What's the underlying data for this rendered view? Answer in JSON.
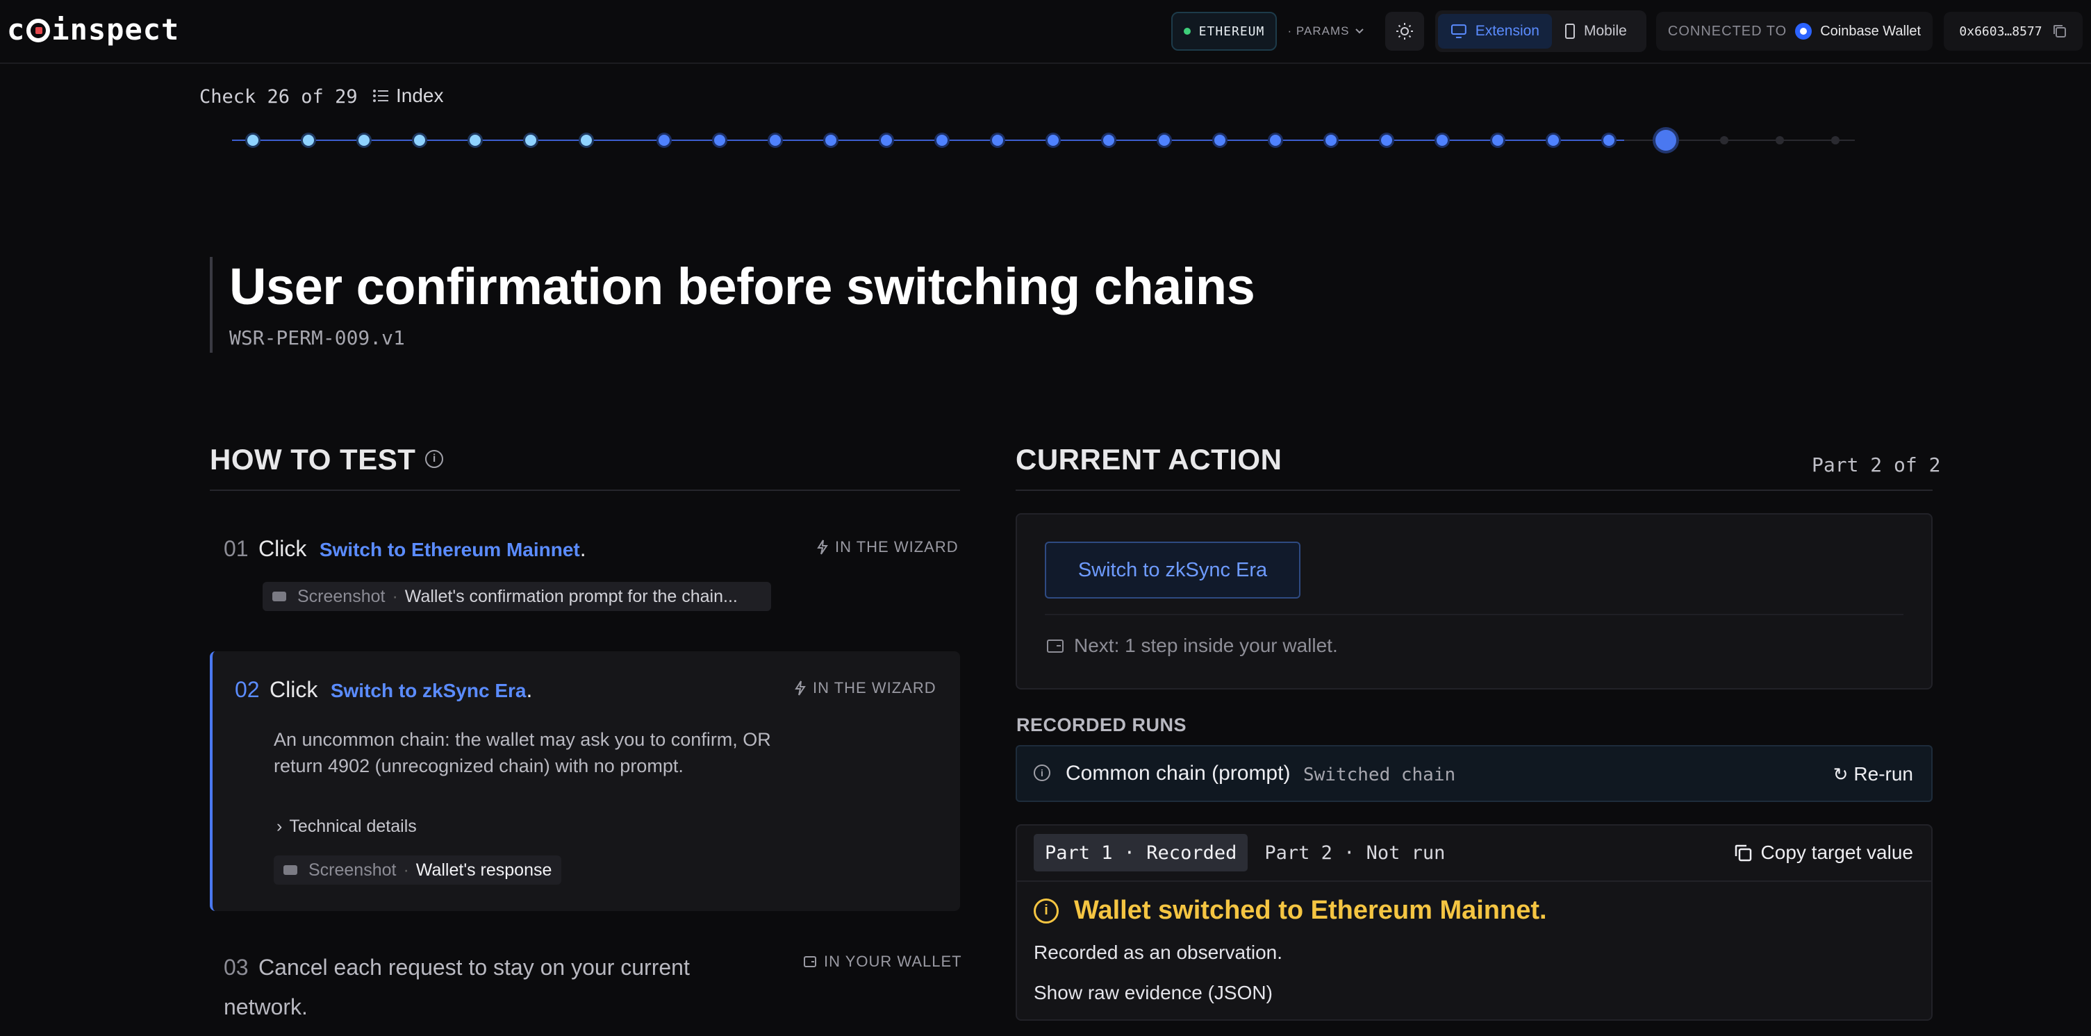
{
  "header": {
    "logo": "coinspect",
    "network": "ETHEREUM",
    "params": "· PARAMS",
    "view_modes": [
      {
        "label": "Extension",
        "active": true
      },
      {
        "label": "Mobile",
        "active": false
      }
    ],
    "connected_to_label": "CONNECTED TO",
    "wallet_name": "Coinbase Wallet",
    "address": "0x6603…8577"
  },
  "progress": {
    "check_label": "Check 26 of 29",
    "index_label": "Index",
    "current": 26,
    "total": 29
  },
  "check": {
    "title": "User confirmation before switching chains",
    "id": "WSR-PERM-009.v1"
  },
  "how_to_test": {
    "heading": "HOW TO TEST",
    "steps": [
      {
        "num": "01",
        "verb": "Click",
        "link": "Switch to Ethereum Mainnet",
        "tail": ".",
        "tag": "IN THE WIZARD",
        "shot_label": "Screenshot",
        "shot_desc": "Wallet's confirmation prompt for the chain..."
      },
      {
        "num": "02",
        "verb": "Click",
        "link": "Switch to zkSync Era",
        "tail": ".",
        "tag": "IN THE WIZARD",
        "description": "An uncommon chain: the wallet may ask you to confirm, OR return 4902 (unrecognized chain) with no prompt.",
        "technical": "Technical details",
        "shot_label": "Screenshot",
        "shot_desc": "Wallet's response"
      },
      {
        "num": "03",
        "text": "Cancel each request to stay on your current network.",
        "tag": "IN YOUR WALLET"
      }
    ]
  },
  "current_action": {
    "heading": "CURRENT ACTION",
    "part": "Part 2 of 2",
    "button": "Switch to zkSync Era",
    "next": "Next: 1 step inside your wallet."
  },
  "recorded_runs": {
    "heading": "RECORDED RUNS",
    "run_name": "Common chain (prompt)",
    "run_result": "Switched chain",
    "rerun": "Re-run",
    "tabs": [
      {
        "label": "Part 1 · Recorded",
        "active": true
      },
      {
        "label": "Part 2 · Not run",
        "active": false
      }
    ],
    "copy_target": "Copy target value",
    "warning": "Wallet switched to Ethereum Mainnet.",
    "observation": "Recorded as an observation.",
    "raw_evidence": "Show raw evidence (JSON)"
  },
  "colors": {
    "accent": "#5b8cff",
    "warning": "#f5c542",
    "success_dot": "#3ecf7a"
  }
}
